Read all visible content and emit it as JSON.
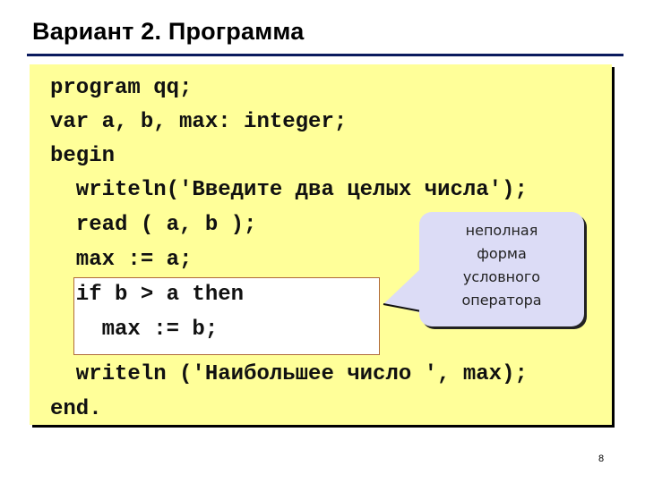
{
  "slide": {
    "title": "Вариант 2. Программа",
    "page_number": "8",
    "colors": {
      "code_background": "#ffff99",
      "title_rule": "#0a1a5e",
      "callout_background": "#dcdcf6",
      "highlight_border": "#b06a3a"
    }
  },
  "code": {
    "lines": [
      "program qq;",
      "var a, b, max: integer;",
      "begin",
      "  writeln('Введите два целых числа');",
      "  read ( a, b );",
      "  max := a;",
      "  if b > a then",
      "    max := b;",
      "  writeln ('Наибольшее число ', max);",
      "end."
    ]
  },
  "callout": {
    "lines": [
      "неполная",
      "форма",
      "условного",
      "оператора"
    ]
  }
}
